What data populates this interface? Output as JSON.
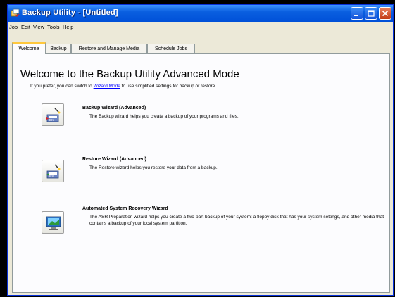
{
  "window": {
    "title": "Backup Utility - [Untitled]"
  },
  "menu": [
    "Job",
    "Edit",
    "View",
    "Tools",
    "Help"
  ],
  "tabs": [
    "Welcome",
    "Backup",
    "Restore and Manage Media",
    "Schedule Jobs"
  ],
  "welcome": {
    "heading": "Welcome to the Backup Utility Advanced Mode",
    "intro_before": "If you prefer, you can switch to ",
    "intro_link": "Wizard Mode",
    "intro_after": " to use simplified settings for backup or restore."
  },
  "wizards": [
    {
      "title": "Backup Wizard (Advanced)",
      "description": "The Backup wizard helps you create a backup of your programs and files.",
      "icon": "backup-wizard-icon"
    },
    {
      "title": "Restore Wizard (Advanced)",
      "description": "The Restore wizard helps you restore your data from a backup.",
      "icon": "restore-wizard-icon"
    },
    {
      "title": "Automated System Recovery Wizard",
      "description": "The ASR Preparation wizard helps you create a two-part backup of your system: a floppy disk that has your system settings, and other media that contains a backup of your local system partition.",
      "icon": "asr-wizard-icon"
    }
  ],
  "colors": {
    "titlebar": "#0a5fe0",
    "window_face": "#ece9d8",
    "tab_highlight": "#ffc83c",
    "link": "#0000ff"
  }
}
